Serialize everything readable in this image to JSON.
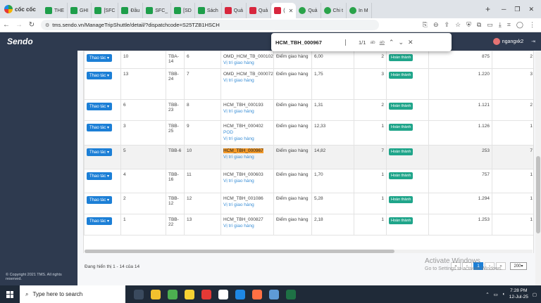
{
  "browser": {
    "brand": "cốc cốc",
    "tabs": [
      {
        "label": "THE",
        "icon": "green"
      },
      {
        "label": "GHI",
        "icon": "green"
      },
      {
        "label": "[SFC",
        "icon": "green"
      },
      {
        "label": "Đầu",
        "icon": "green"
      },
      {
        "label": "SFC_",
        "icon": "green"
      },
      {
        "label": "[SD",
        "icon": "green"
      },
      {
        "label": "Sách",
        "icon": "green"
      },
      {
        "label": "Quả",
        "icon": "red"
      },
      {
        "label": "Quả",
        "icon": "red"
      },
      {
        "label": "(",
        "icon": "red",
        "active": true
      },
      {
        "label": "Quả",
        "icon": "circle"
      },
      {
        "label": "Chi t",
        "icon": "circle"
      },
      {
        "label": "In M",
        "icon": "circle"
      }
    ],
    "url": "tms.sendo.vn/ManageTripShuttle/detail/?dispatchcode=S25TZB1HSCH"
  },
  "app": {
    "logo": "Sendo",
    "user": "ngangxk2",
    "copyright": "© Copyright 2021 TMS. All rights reserved."
  },
  "find": {
    "query": "HCM_TBH_000967",
    "count": "1/1",
    "match_case": "ab",
    "whole_word": "ab"
  },
  "table": {
    "action_label": "Thao tác",
    "rows": [
      {
        "stt": "10",
        "bag": "TBA-14",
        "seq": "6",
        "order": "OMD_HCM_TB_000102",
        "links": [
          "Vị trí giao hàng"
        ],
        "type": "Điểm giao hàng",
        "weight": "6,00",
        "qty": "2",
        "status": "Hoàn thành",
        "value": "875",
        "qty2": "2"
      },
      {
        "stt": "13",
        "bag": "TBB-24",
        "seq": "7",
        "order": "OMD_HCM_TB_000072",
        "links": [
          "Vị trí giao hàng"
        ],
        "type": "Điểm giao hàng",
        "weight": "1,75",
        "qty": "3",
        "status": "Hoàn thành",
        "value": "1.220",
        "qty2": "3"
      },
      {
        "stt": "6",
        "bag": "TBB-23",
        "seq": "8",
        "order": "HCM_TBH_000193",
        "links": [
          "Vị trí giao hàng"
        ],
        "type": "Điểm giao hàng",
        "weight": "1,31",
        "qty": "2",
        "status": "Hoàn thành",
        "value": "1.121",
        "qty2": "2"
      },
      {
        "stt": "3",
        "bag": "TBB-25",
        "seq": "9",
        "order": "HCM_TBH_000402",
        "links": [
          "POD",
          "Vị trí giao hàng"
        ],
        "type": "Điểm giao hàng",
        "weight": "12,33",
        "qty": "1",
        "status": "Hoàn thành",
        "value": "1.126",
        "qty2": "1"
      },
      {
        "stt": "5",
        "bag": "TBB-6",
        "seq": "10",
        "order": "HCM_TBH_000967",
        "links": [
          "Vị trí giao hàng"
        ],
        "type": "Điểm giao hàng",
        "weight": "14,82",
        "qty": "7",
        "status": "Hoàn thành",
        "value": "253",
        "qty2": "7",
        "highlight": true
      },
      {
        "stt": "4",
        "bag": "TBB-16",
        "seq": "11",
        "order": "HCM_TBH_000603",
        "links": [
          "Vị trí giao hàng"
        ],
        "type": "Điểm giao hàng",
        "weight": "1,70",
        "qty": "1",
        "status": "Hoàn thành",
        "value": "757",
        "qty2": "1"
      },
      {
        "stt": "2",
        "bag": "TBB-12",
        "seq": "12",
        "order": "HCM_TBH_001086",
        "links": [
          "Vị trí giao hàng"
        ],
        "type": "Điểm giao hàng",
        "weight": "5,28",
        "qty": "1",
        "status": "Hoàn thành",
        "value": "1.294",
        "qty2": "1"
      },
      {
        "stt": "1",
        "bag": "TBB-22",
        "seq": "13",
        "order": "HCM_TBH_000827",
        "links": [
          "Vị trí giao hàng"
        ],
        "type": "Điểm giao hàng",
        "weight": "2,18",
        "qty": "1",
        "status": "Hoàn thành",
        "value": "1.253",
        "qty2": "1"
      }
    ]
  },
  "footer": {
    "info": "Đang hiển thị 1 - 14 của 14",
    "current_page": "1",
    "page_size": "200"
  },
  "watermark": {
    "line1": "Activate Windows",
    "line2": "Go to Settings to activate Windows."
  },
  "taskbar": {
    "search_placeholder": "Type here to search",
    "time": "7:28 PM",
    "date": "12-Jul-25"
  }
}
